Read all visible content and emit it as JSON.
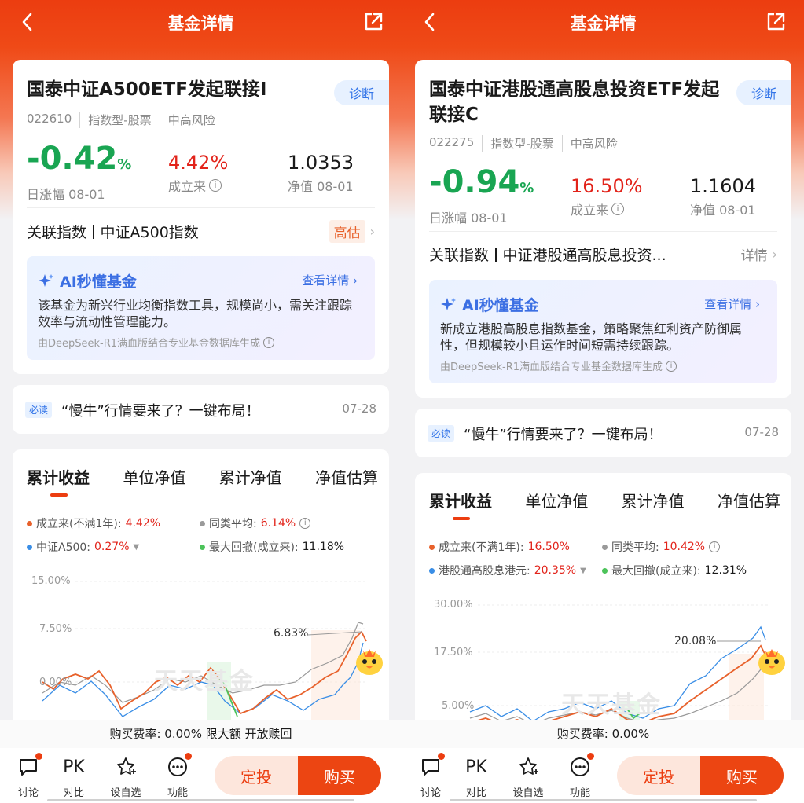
{
  "common": {
    "nav_title": "基金详情",
    "diag_label": "诊断",
    "rel_label": "关联指数",
    "ai_title": "AI秒懂基金",
    "ai_more": "查看详情",
    "ai_footer": "由DeepSeek-R1满血版结合专业基金数据库生成",
    "news_badge": "必读",
    "news_text": "“慢牛”行情要来了？一键布局！",
    "news_date": "07-28",
    "tabs": [
      "累计收益",
      "单位净值",
      "累计净值",
      "净值估算"
    ],
    "stat_labels": {
      "daily": "日涨幅 08-01",
      "since": "成立来",
      "nav": "净值 08-01"
    },
    "bottom": {
      "discuss": "讨论",
      "pk": "PK",
      "compare": "对比",
      "watch": "设自选",
      "func": "功能",
      "fixed": "定投",
      "buy": "购买"
    },
    "colors": {
      "accent": "#ec3d10",
      "green": "#19a552",
      "red": "#e2231a",
      "blue": "#3b6fe3"
    }
  },
  "left": {
    "fund_name": "国泰中证A500ETF发起联接I",
    "code": "022610",
    "type": "指数型-股票",
    "risk": "中高风险",
    "daily_change_num": "-0.42",
    "daily_change_unit": "%",
    "since_return": "4.42%",
    "nav": "1.0353",
    "rel_index": "中证A500指数",
    "rel_tag": "高估",
    "ai_text": "该基金为新兴行业均衡指数工具，规模尚小，需关注跟踪效率与流动性管理能力。",
    "legend": {
      "a_label": "成立来(不满1年):",
      "a_val": "4.42%",
      "b_label": "同类平均:",
      "b_val": "6.14%",
      "c_label": "中证A500:",
      "c_val": "0.27%",
      "d_label": "最大回撤(成立来):",
      "d_val": "11.18%"
    },
    "y_ticks": [
      "15.00%",
      "7.50%",
      "0.00%"
    ],
    "callout": "6.83%",
    "watermark": "天天基金",
    "fee": "购买费率: 0.00% 限大额 开放赎回"
  },
  "right": {
    "fund_name": "国泰中证港股通高股息投资ETF发起联接C",
    "code": "022275",
    "type": "指数型-股票",
    "risk": "中高风险",
    "daily_change_num": "-0.94",
    "daily_change_unit": "%",
    "since_return": "16.50%",
    "nav": "1.1604",
    "rel_index": "中证港股通高股息投资...",
    "rel_tag": "详情",
    "ai_text": "新成立港股高股息指数基金，策略聚焦红利资产防御属性，但规模较小且运作时间短需持续跟踪。",
    "legend": {
      "a_label": "成立来(不满1年):",
      "a_val": "16.50%",
      "b_label": "同类平均:",
      "b_val": "10.42%",
      "c_label": "港股通高股息港元:",
      "c_val": "20.35%",
      "d_label": "最大回撤(成立来):",
      "d_val": "12.31%"
    },
    "y_ticks": [
      "30.00%",
      "17.50%",
      "5.00%"
    ],
    "callout": "20.08%",
    "watermark": "天天基金",
    "fee": "购买费率: 0.00%"
  }
}
